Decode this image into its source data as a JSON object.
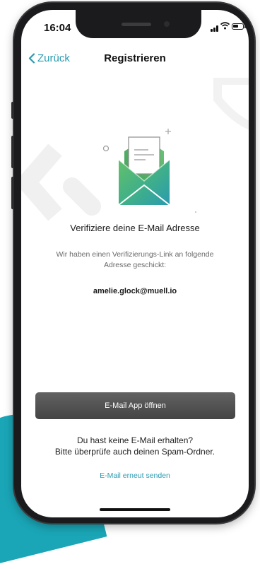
{
  "status_bar": {
    "time": "16:04",
    "icons": [
      "signal-icon",
      "wifi-icon",
      "battery-icon"
    ]
  },
  "nav": {
    "back_label": "Zurück",
    "title": "Registrieren"
  },
  "verification": {
    "headline": "Verifiziere deine E-Mail Adresse",
    "description": "Wir haben einen Verifizierungs-Link an folgende Adresse geschickt:",
    "email": "amelie.glock@muell.io"
  },
  "actions": {
    "open_mail_label": "E-Mail App öffnen",
    "hint_line1": "Du hast keine E-Mail erhalten?",
    "hint_line2": "Bitte überprüfe auch deinen Spam-Ordner.",
    "resend_label": "E-Mail erneut senden"
  },
  "colors": {
    "accent": "#2a9bb0",
    "button": "#4f4f4f",
    "brand_teal": "#1aa6b7",
    "envelope_green": "#4fb57a"
  }
}
